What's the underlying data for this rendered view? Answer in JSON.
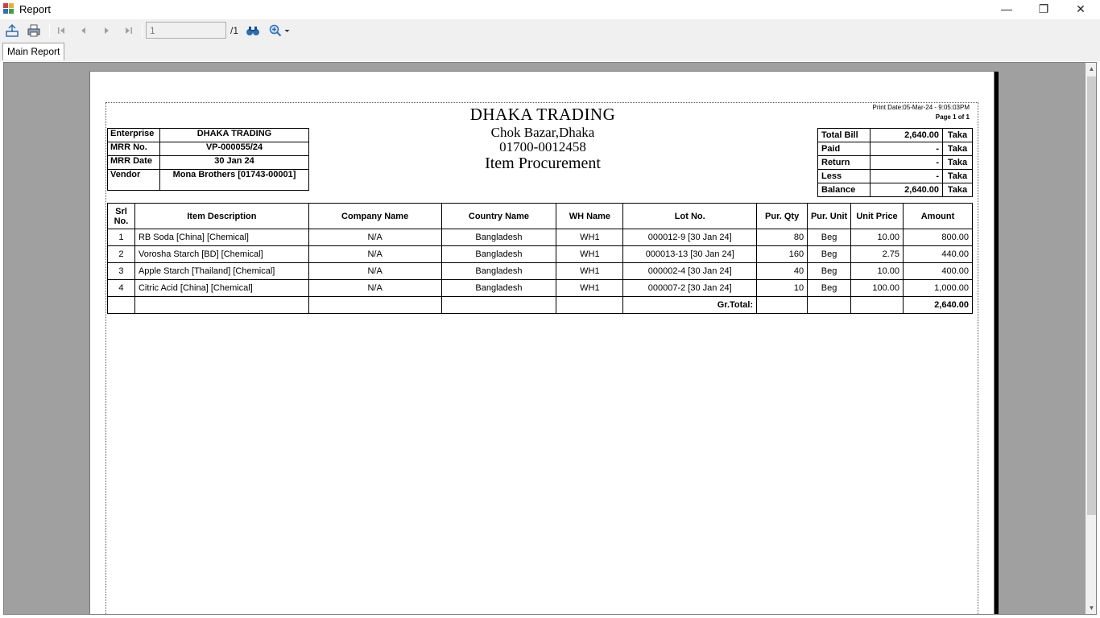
{
  "window": {
    "title": "Report",
    "minimize_glyph": "—",
    "maximize_glyph": "❐",
    "close_glyph": "✕"
  },
  "toolbar": {
    "page_value": "1",
    "page_total": "/1",
    "icons": [
      "export-icon",
      "print-icon",
      "first-page-icon",
      "previous-page-icon",
      "next-page-icon",
      "last-page-icon",
      "find-icon",
      "zoom-icon"
    ]
  },
  "tabs": [
    {
      "label": "Main Report"
    }
  ],
  "report": {
    "company": "DHAKA TRADING",
    "address": "Chok Bazar,Dhaka",
    "phone": "01700-0012458",
    "doc_title": "Item Procurement",
    "print_date": "Print Date:05-Mar-24 -  9:05:03PM",
    "page_of": "Page 1 of 1",
    "info": [
      {
        "key": "Enterprise",
        "value": "DHAKA TRADING"
      },
      {
        "key": "MRR No.",
        "value": "VP-000055/24"
      },
      {
        "key": "MRR Date",
        "value": "30 Jan 24"
      },
      {
        "key": "Vendor",
        "value": "Mona Brothers [01743-00001]"
      }
    ],
    "summary": [
      {
        "key": "Total Bill",
        "value": "2,640.00",
        "unit": "Taka"
      },
      {
        "key": "Paid",
        "value": "-",
        "unit": "Taka"
      },
      {
        "key": "Return",
        "value": "-",
        "unit": "Taka"
      },
      {
        "key": "Less",
        "value": "-",
        "unit": "Taka"
      },
      {
        "key": "Balance",
        "value": "2,640.00",
        "unit": "Taka"
      }
    ],
    "columns": {
      "srl": "Srl No.",
      "item": "Item Description",
      "company": "Company Name",
      "country": "Country Name",
      "wh": "WH Name",
      "lot": "Lot No.",
      "qty": "Pur. Qty",
      "unit": "Pur. Unit",
      "price": "Unit Price",
      "amount": "Amount"
    },
    "rows": [
      {
        "srl": "1",
        "item": "RB Soda [China] [Chemical]",
        "company": "N/A",
        "country": "Bangladesh",
        "wh": "WH1",
        "lot": "000012-9 [30 Jan 24]",
        "qty": "80",
        "unit": "Beg",
        "price": "10.00",
        "amount": "800.00"
      },
      {
        "srl": "2",
        "item": "Vorosha Starch [BD] [Chemical]",
        "company": "N/A",
        "country": "Bangladesh",
        "wh": "WH1",
        "lot": "000013-13 [30 Jan 24]",
        "qty": "160",
        "unit": "Beg",
        "price": "2.75",
        "amount": "440.00"
      },
      {
        "srl": "3",
        "item": "Apple Starch [Thailand] [Chemical]",
        "company": "N/A",
        "country": "Bangladesh",
        "wh": "WH1",
        "lot": "000002-4 [30 Jan 24]",
        "qty": "40",
        "unit": "Beg",
        "price": "10.00",
        "amount": "400.00"
      },
      {
        "srl": "4",
        "item": "Citric Acid [China] [Chemical]",
        "company": "N/A",
        "country": "Bangladesh",
        "wh": "WH1",
        "lot": "000007-2 [30 Jan 24]",
        "qty": "10",
        "unit": "Beg",
        "price": "100.00",
        "amount": "1,000.00"
      }
    ],
    "total_label": "Gr.Total:",
    "total_amount": "2,640.00"
  },
  "colors": {
    "viewer_bg": "#a0a0a0",
    "toolbar_bg": "#f0f0f0",
    "icon_blue": "#2a6fb5"
  }
}
